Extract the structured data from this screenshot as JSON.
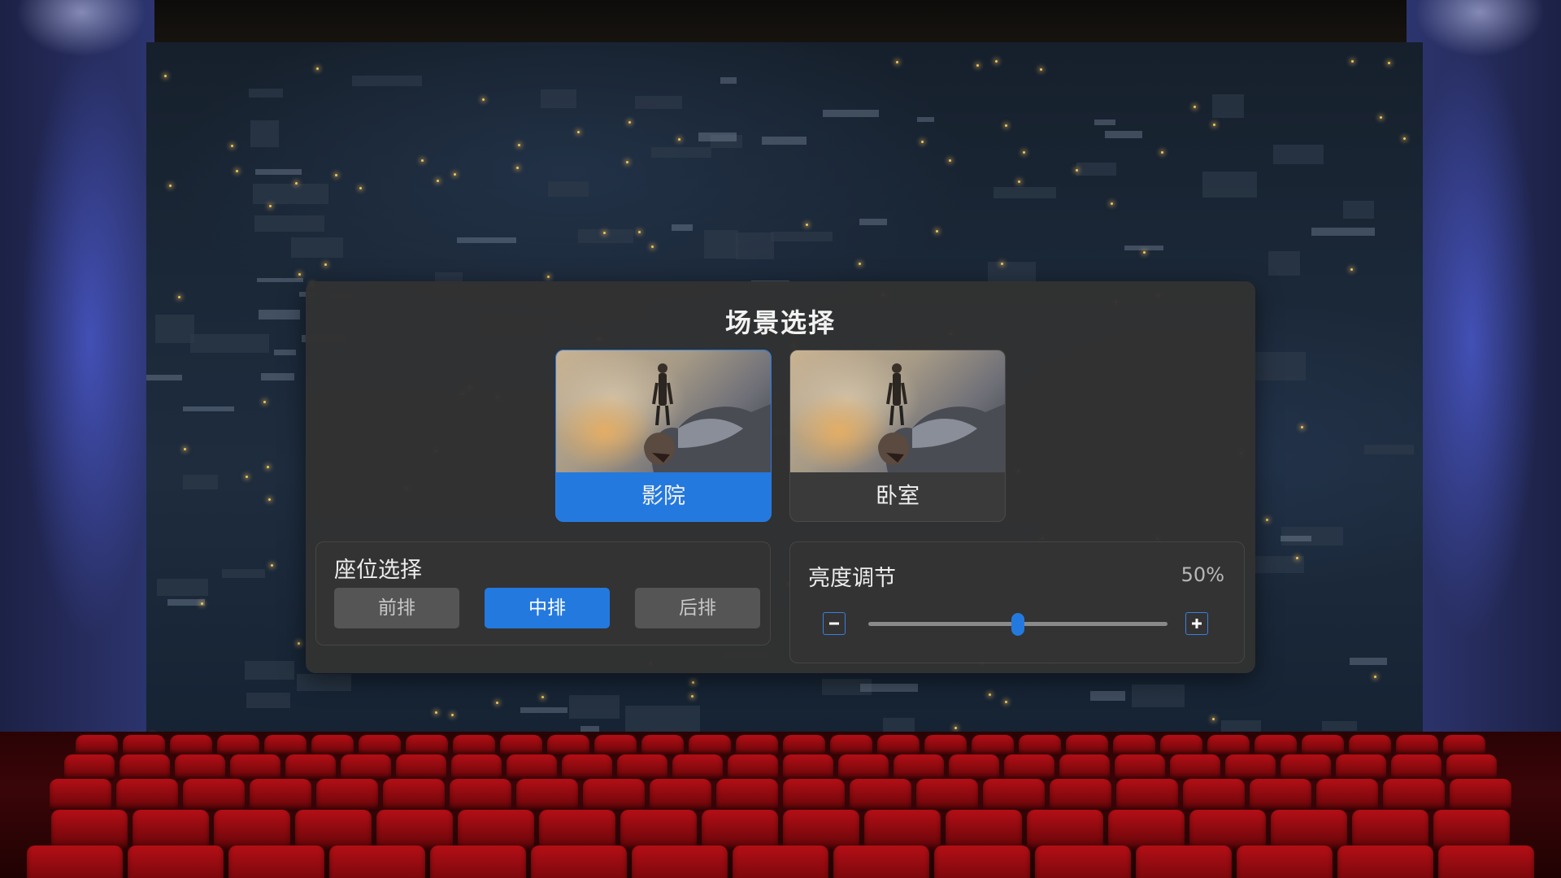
{
  "dialog": {
    "title": "场景选择",
    "scenes": [
      {
        "label": "影院",
        "selected": true
      },
      {
        "label": "卧室",
        "selected": false
      }
    ],
    "seat": {
      "title": "座位选择",
      "options": [
        {
          "label": "前排",
          "active": false
        },
        {
          "label": "中排",
          "active": true
        },
        {
          "label": "后排",
          "active": false
        }
      ]
    },
    "brightness": {
      "title": "亮度调节",
      "value_text": "50%",
      "value": 0.5,
      "decrease_icon": "minus-icon",
      "increase_icon": "plus-icon"
    }
  },
  "colors": {
    "accent": "#2479de",
    "dialog_bg": "#323232",
    "seat_red": "#b40f16",
    "wall_blue": "#262c5c"
  }
}
